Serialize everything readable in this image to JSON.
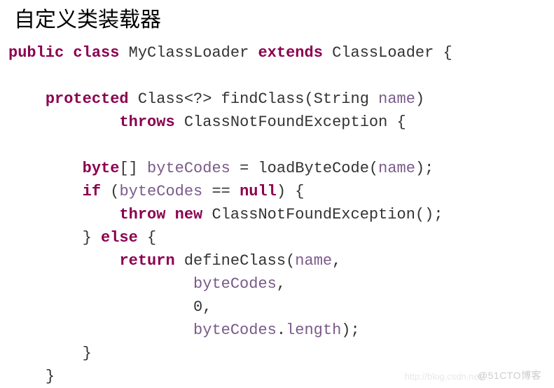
{
  "title": "自定义类装载器",
  "code": {
    "l1_public": "public",
    "l1_class": "class",
    "l1_classname": "MyClassLoader",
    "l1_extends": "extends",
    "l1_parent": "ClassLoader",
    "l1_brace": " {",
    "l2_protected": "protected",
    "l2_type": "Class<?>",
    "l2_method": "findClass",
    "l2_paren_open": "(",
    "l2_param_type": "String",
    "l2_param_name": "name",
    "l2_paren_close": ")",
    "l3_throws": "throws",
    "l3_exception": "ClassNotFoundException",
    "l3_brace": " {",
    "l4_byte": "byte",
    "l4_arr": "[] ",
    "l4_var": "byteCodes",
    "l4_eq": " = ",
    "l4_call": "loadByteCode",
    "l4_po": "(",
    "l4_arg": "name",
    "l4_pc": ");",
    "l5_if": "if",
    "l5_po": " (",
    "l5_var": "byteCodes",
    "l5_eq": " == ",
    "l5_null": "null",
    "l5_pc": ") {",
    "l6_throw": "throw",
    "l6_new": "new",
    "l6_exc": " ClassNotFoundException();",
    "l7_cb": "} ",
    "l7_else": "else",
    "l7_ob": " {",
    "l8_return": "return",
    "l8_call": " defineClass(",
    "l8_arg": "name",
    "l8_comma": ",",
    "l9_arg": "byteCodes",
    "l9_comma": ",",
    "l10_arg": "0,",
    "l11_arg": "byteCodes",
    "l11_dot": ".",
    "l11_field": "length",
    "l11_end": ");",
    "l12_cb": "}",
    "l13_cb": "}"
  },
  "watermark": "@51CTO博客",
  "watermark2": "http://blog.csdn.net/"
}
